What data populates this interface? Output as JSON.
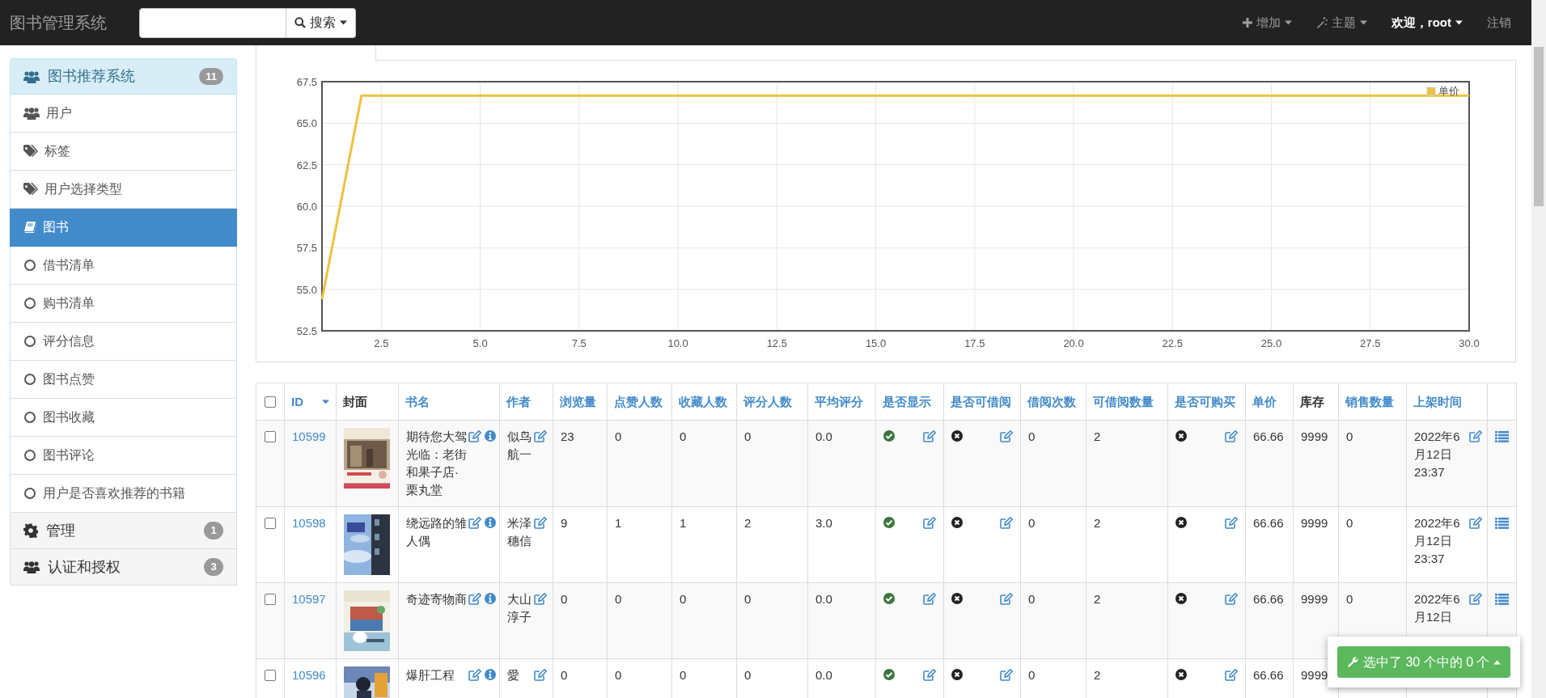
{
  "navbar": {
    "brand": "图书管理系统",
    "search_button": "搜索",
    "menus": [
      {
        "kind": "add",
        "label": "增加"
      },
      {
        "kind": "theme",
        "label": "主题"
      },
      {
        "kind": "user",
        "label": "欢迎，root"
      },
      {
        "kind": "link",
        "label": "注销"
      }
    ]
  },
  "sidebar": {
    "groups": [
      {
        "kind": "users",
        "label": "图书推荐系统",
        "badge": "11",
        "expanded": true,
        "items": [
          {
            "kind": "users",
            "label": "用户",
            "selected": false
          },
          {
            "kind": "tags",
            "label": "标签",
            "selected": false
          },
          {
            "kind": "tags",
            "label": "用户选择类型",
            "selected": false
          },
          {
            "kind": "book",
            "label": "图书",
            "selected": true
          },
          {
            "kind": "circle",
            "label": "借书清单",
            "selected": false
          },
          {
            "kind": "circle",
            "label": "购书清单",
            "selected": false
          },
          {
            "kind": "circle",
            "label": "评分信息",
            "selected": false
          },
          {
            "kind": "circle",
            "label": "图书点赞",
            "selected": false
          },
          {
            "kind": "circle",
            "label": "图书收藏",
            "selected": false
          },
          {
            "kind": "circle",
            "label": "图书评论",
            "selected": false
          },
          {
            "kind": "circle",
            "label": "用户是否喜欢推荐的书籍",
            "selected": false
          }
        ]
      },
      {
        "kind": "gear",
        "label": "管理",
        "badge": "1",
        "expanded": false
      },
      {
        "kind": "users",
        "label": "认证和授权",
        "badge": "3",
        "expanded": false
      }
    ]
  },
  "chart": {
    "chart_data": {
      "type": "line",
      "x": [
        1,
        2,
        3,
        4,
        5,
        6,
        7,
        8,
        9,
        10,
        11,
        12,
        13,
        14,
        15,
        16,
        17,
        18,
        19,
        20,
        21,
        22,
        23,
        24,
        25,
        26,
        27,
        28,
        29,
        30
      ],
      "series": [
        {
          "name": "单价",
          "color": "#edc240",
          "values": [
            54.4,
            66.66,
            66.66,
            66.66,
            66.66,
            66.66,
            66.66,
            66.66,
            66.66,
            66.66,
            66.66,
            66.66,
            66.66,
            66.66,
            66.66,
            66.66,
            66.66,
            66.66,
            66.66,
            66.66,
            66.66,
            66.66,
            66.66,
            66.66,
            66.66,
            66.66,
            66.66,
            66.66,
            66.66,
            66.66
          ]
        }
      ],
      "xlim": [
        1,
        30
      ],
      "ylim": [
        52.5,
        67.5
      ],
      "grid": true,
      "xticks": [
        {
          "value": 2.5,
          "label": "2.5"
        },
        {
          "value": 5,
          "label": "5.0"
        },
        {
          "value": 7.5,
          "label": "7.5"
        },
        {
          "value": 10,
          "label": "10.0"
        },
        {
          "value": 12.5,
          "label": "12.5"
        },
        {
          "value": 15,
          "label": "15.0"
        },
        {
          "value": 17.5,
          "label": "17.5"
        },
        {
          "value": 20,
          "label": "20.0"
        },
        {
          "value": 22.5,
          "label": "22.5"
        },
        {
          "value": 25,
          "label": "25.0"
        },
        {
          "value": 27.5,
          "label": "27.5"
        },
        {
          "value": 30,
          "label": "30.0"
        }
      ],
      "yticks": [
        {
          "value": 52.5,
          "label": "52.5"
        },
        {
          "value": 55,
          "label": "55.0"
        },
        {
          "value": 57.5,
          "label": "57.5"
        },
        {
          "value": 60,
          "label": "60.0"
        },
        {
          "value": 62.5,
          "label": "62.5"
        },
        {
          "value": 65,
          "label": "65.0"
        },
        {
          "value": 67.5,
          "label": "67.5"
        }
      ]
    }
  },
  "table": {
    "select_all": {
      "checked": false
    },
    "columns": [
      {
        "label": "ID",
        "sortable": true,
        "sorted": true
      },
      {
        "label": "封面",
        "sortable": false,
        "sorted": false
      },
      {
        "label": "书名",
        "sortable": true,
        "sorted": false
      },
      {
        "label": "作者",
        "sortable": true,
        "sorted": false
      },
      {
        "label": "浏览量",
        "sortable": true,
        "sorted": false
      },
      {
        "label": "点赞人数",
        "sortable": true,
        "sorted": false
      },
      {
        "label": "收藏人数",
        "sortable": true,
        "sorted": false
      },
      {
        "label": "评分人数",
        "sortable": true,
        "sorted": false
      },
      {
        "label": "平均评分",
        "sortable": true,
        "sorted": false
      },
      {
        "label": "是否显示",
        "sortable": true,
        "sorted": false
      },
      {
        "label": "是否可借阅",
        "sortable": true,
        "sorted": false
      },
      {
        "label": "借阅次数",
        "sortable": true,
        "sorted": false
      },
      {
        "label": "可借阅数量",
        "sortable": true,
        "sorted": false
      },
      {
        "label": "是否可购买",
        "sortable": true,
        "sorted": false
      },
      {
        "label": "单价",
        "sortable": true,
        "sorted": false
      },
      {
        "label": "库存",
        "sortable": false,
        "sorted": false
      },
      {
        "label": "销售数量",
        "sortable": true,
        "sorted": false
      },
      {
        "label": "上架时间",
        "sortable": true,
        "sorted": false
      }
    ],
    "rows": [
      {
        "checked": false,
        "id": "10599",
        "title": "期待您大驾光临：老街和果子店·栗丸堂",
        "author": "似鸟航一",
        "views": "23",
        "likes": "0",
        "favorites": "0",
        "ratings": "0",
        "average": "0.0",
        "shown": true,
        "borrowable": false,
        "borrow_count": "0",
        "borrowable_qty": "2",
        "buyable": false,
        "price": "66.66",
        "stock": "9999",
        "sales": "0",
        "listed": "2022年6月12日 23:37"
      },
      {
        "checked": false,
        "id": "10598",
        "title": "绕远路的雏人偶",
        "author": "米泽穗信",
        "views": "9",
        "likes": "1",
        "favorites": "1",
        "ratings": "2",
        "average": "3.0",
        "shown": true,
        "borrowable": false,
        "borrow_count": "0",
        "borrowable_qty": "2",
        "buyable": false,
        "price": "66.66",
        "stock": "9999",
        "sales": "0",
        "listed": "2022年6月12日 23:37"
      },
      {
        "checked": false,
        "id": "10597",
        "title": "奇迹寄物商",
        "author": "大山淳子",
        "views": "0",
        "likes": "0",
        "favorites": "0",
        "ratings": "0",
        "average": "0.0",
        "shown": true,
        "borrowable": false,
        "borrow_count": "0",
        "borrowable_qty": "2",
        "buyable": false,
        "price": "66.66",
        "stock": "9999",
        "sales": "0",
        "listed": "2022年6月12日"
      },
      {
        "checked": false,
        "id": "10596",
        "title": "爆肝工程",
        "author": "愛",
        "views": "0",
        "likes": "0",
        "favorites": "0",
        "ratings": "0",
        "average": "0.0",
        "shown": true,
        "borrowable": false,
        "borrow_count": "0",
        "borrowable_qty": "2",
        "buyable": false,
        "price": "66.66",
        "stock": "9999"
      }
    ]
  },
  "selection_button": "选中了 30 个中的 0 个"
}
